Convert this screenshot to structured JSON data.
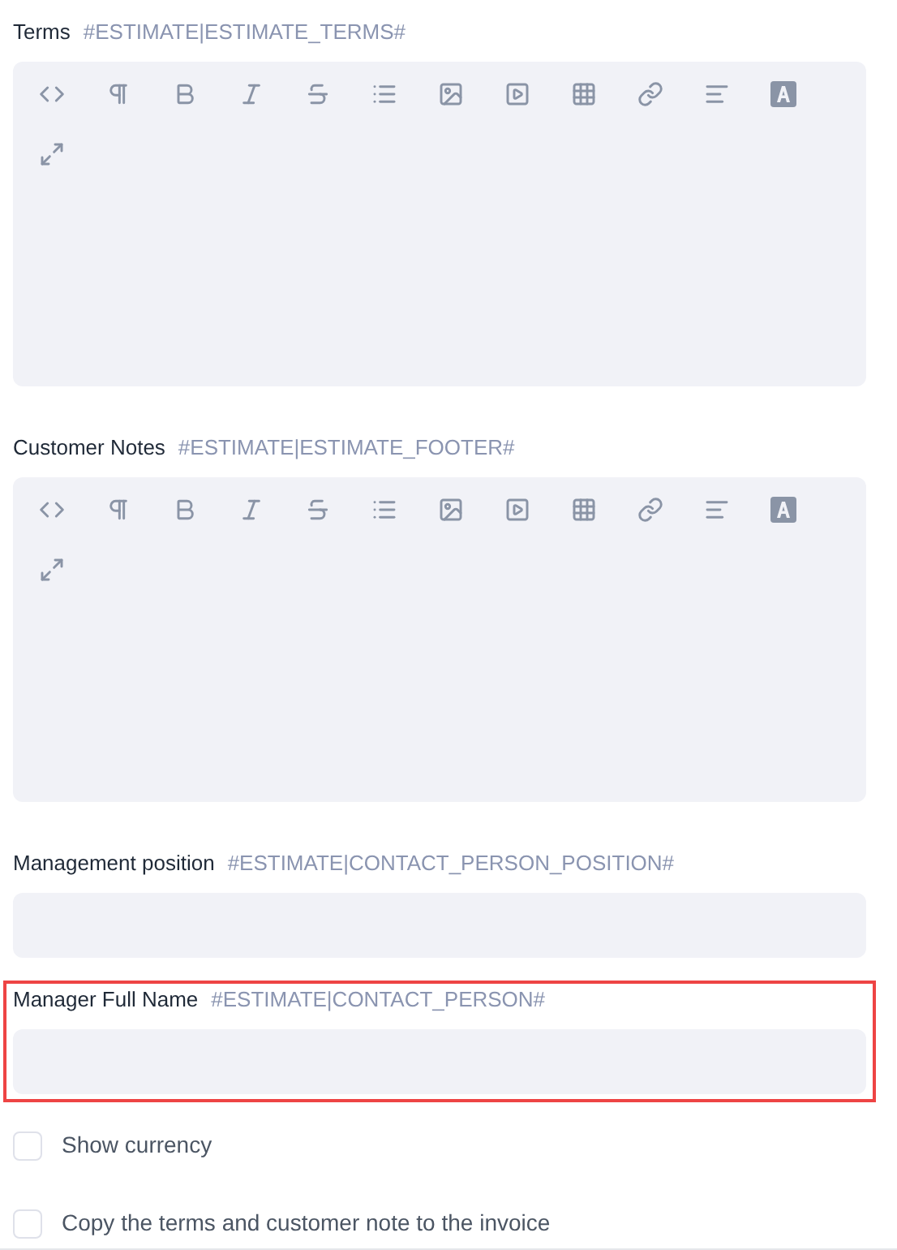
{
  "fields": [
    {
      "kind": "editor",
      "label": "Terms",
      "tag": "#ESTIMATE|ESTIMATE_TERMS#",
      "highlighted": false
    },
    {
      "kind": "editor",
      "label": "Customer Notes",
      "tag": "#ESTIMATE|ESTIMATE_FOOTER#",
      "highlighted": false
    },
    {
      "kind": "input",
      "label": "Management position",
      "tag": "#ESTIMATE|CONTACT_PERSON_POSITION#",
      "highlighted": false
    },
    {
      "kind": "input",
      "label": "Manager Full Name",
      "tag": "#ESTIMATE|CONTACT_PERSON#",
      "highlighted": true
    }
  ],
  "checkboxes": [
    {
      "label": "Show currency",
      "checked": false
    },
    {
      "label": "Copy the terms and customer note to the invoice",
      "checked": false
    }
  ]
}
